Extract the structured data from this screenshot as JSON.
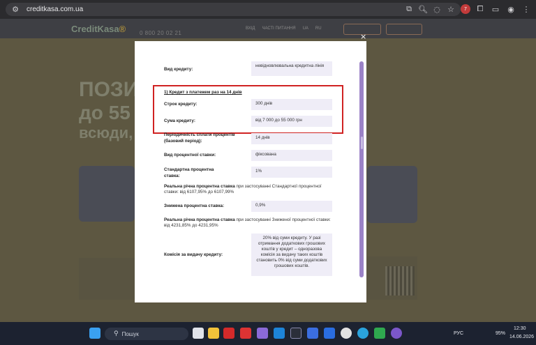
{
  "browser": {
    "url": "creditkasa.com.ua",
    "notification_count": "7"
  },
  "site": {
    "logo_main": "CreditKasa",
    "logo_accent": "®",
    "phone": "0 800 20 02 21",
    "nav": [
      "ВХІД",
      "ЧАСТІ ПИТАННЯ",
      "UA",
      "RU"
    ],
    "hero_line1": "ПОЗИ",
    "hero_line2": "до 55",
    "hero_line3": "всюди, д"
  },
  "modal": {
    "close": "×",
    "loan_type_label": "Вид кредиту:",
    "loan_type_value": "невідновлювальна кредитна лінія",
    "section_title": "1) Кредит з платежем раз на 14 днів",
    "term_label": "Строк кредиту:",
    "term_value": "300 днів",
    "amount_label": "Сума кредиту:",
    "amount_value": "від 7 000 до 55 000 грн",
    "period_label": "Періодичність сплати процентів (базовий період):",
    "period_value": "14 днів",
    "rate_type_label": "Вид процентної ставки:",
    "rate_type_value": "фіксована",
    "std_rate_label": "Стандартна процентна ставка:",
    "std_rate_value": "1%",
    "real_std_bold": "Реальна річна процентна ставка",
    "real_std_rest": " при застосуванні Стандартної процентної ставки: від 6107,95% до 6107,99%",
    "reduced_label": "Знижена процентна ставка:",
    "reduced_value": "0,9%",
    "real_red_bold": "Реальна річна процентна ставка",
    "real_red_rest": " при застосуванні Зниженої процентної ставки: від 4231,85% до 4231,95%",
    "fee_label": "Комісія за видачу кредиту:",
    "fee_value": "20% від суми кредиту. У разі отримання додаткових грошових коштів у кредит – одноразова комісія за видачу таких коштів становить 0% від суми додаткових грошових коштів."
  },
  "taskbar": {
    "search": "Пошук",
    "lang": "РУС",
    "battery": "95%",
    "time": "12:30",
    "date": "14.06.2026"
  }
}
